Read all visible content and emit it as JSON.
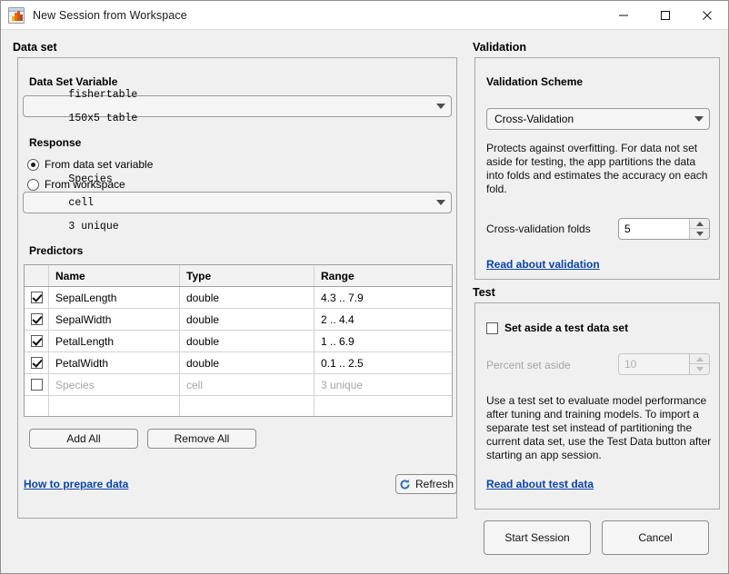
{
  "window": {
    "title": "New Session from Workspace",
    "icon": "matlab-app-icon",
    "minimize_label": "Minimize",
    "maximize_label": "Maximize",
    "close_label": "Close"
  },
  "dataset": {
    "group_title": "Data set",
    "variable_label": "Data Set Variable",
    "variable_combo": {
      "name": "fishertable",
      "size": "150x5 table"
    },
    "response_label": "Response",
    "response_options": [
      {
        "label": "From data set variable",
        "selected": true
      },
      {
        "label": "From workspace",
        "selected": false
      }
    ],
    "response_combo": {
      "name": "Species",
      "type": "cell",
      "detail": "3 unique"
    },
    "predictors_label": "Predictors",
    "table": {
      "headers": [
        "",
        "Name",
        "Type",
        "Range"
      ],
      "rows": [
        {
          "checked": true,
          "name": "SepalLength",
          "type": "double",
          "range": "4.3 .. 7.9",
          "enabled": true
        },
        {
          "checked": true,
          "name": "SepalWidth",
          "type": "double",
          "range": "2 .. 4.4",
          "enabled": true
        },
        {
          "checked": true,
          "name": "PetalLength",
          "type": "double",
          "range": "1 .. 6.9",
          "enabled": true
        },
        {
          "checked": true,
          "name": "PetalWidth",
          "type": "double",
          "range": "0.1 .. 2.5",
          "enabled": true
        },
        {
          "checked": false,
          "name": "Species",
          "type": "cell",
          "range": "3 unique",
          "enabled": false
        }
      ]
    },
    "add_all_label": "Add All",
    "remove_all_label": "Remove All",
    "how_to_link": "How to prepare data",
    "refresh_label": "Refresh",
    "refresh_icon": "refresh-icon"
  },
  "validation": {
    "group_title": "Validation",
    "scheme_label": "Validation Scheme",
    "scheme_value": "Cross-Validation",
    "description": "Protects against overfitting. For data not set aside for testing, the app partitions the data into folds and estimates the accuracy on each fold.",
    "folds_label": "Cross-validation folds",
    "folds_value": "5",
    "read_link": "Read about validation"
  },
  "test": {
    "group_title": "Test",
    "set_aside_label": "Set aside a test data set",
    "set_aside_checked": false,
    "percent_label": "Percent set aside",
    "percent_value": "10",
    "description": "Use a test set to evaluate model performance after tuning and training models. To import a separate test set instead of partitioning the current data set, use the Test Data button after starting an app session.",
    "read_link": "Read about test data"
  },
  "footer": {
    "start_label": "Start Session",
    "cancel_label": "Cancel"
  },
  "colors": {
    "background": "#f0f0f0",
    "panel_border": "#a8a8a8",
    "link": "#0b43a8",
    "titlebar": "#ffffff",
    "disabled_text": "#a6a6a6"
  }
}
